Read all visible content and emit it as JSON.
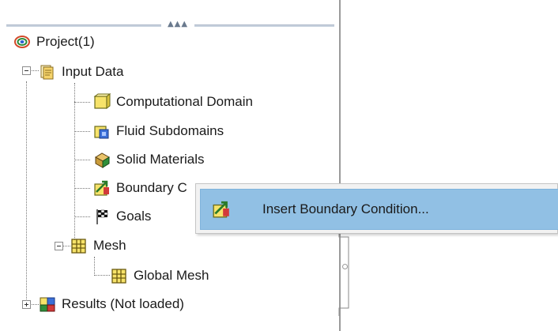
{
  "tree": {
    "project": {
      "label": "Project(1)",
      "icon": "project-icon"
    },
    "input_data": {
      "label": "Input Data",
      "icon": "input-data-icon",
      "expanded": true
    },
    "computational_domain": {
      "label": "Computational Domain",
      "icon": "computational-domain-icon"
    },
    "fluid_subdomains": {
      "label": "Fluid Subdomains",
      "icon": "fluid-subdomains-icon"
    },
    "solid_materials": {
      "label": "Solid Materials",
      "icon": "solid-materials-icon"
    },
    "boundary_conditions": {
      "label": "Boundary C",
      "icon": "boundary-conditions-icon"
    },
    "goals": {
      "label": "Goals",
      "icon": "goals-flag-icon"
    },
    "mesh": {
      "label": "Mesh",
      "icon": "mesh-icon",
      "expanded": true
    },
    "global_mesh": {
      "label": "Global Mesh",
      "icon": "global-mesh-icon"
    },
    "results": {
      "label": "Results (Not loaded)",
      "icon": "results-icon",
      "expanded": false
    }
  },
  "context_menu": {
    "items": [
      {
        "label": "Insert Boundary Condition...",
        "icon": "insert-boundary-condition-icon",
        "highlighted": true
      }
    ]
  },
  "splitter": {
    "grip": "▲▲▲"
  },
  "colors": {
    "menu_highlight": "#91c0e4",
    "menu_background": "#f2f2f2",
    "divider": "#9a9a9a"
  }
}
